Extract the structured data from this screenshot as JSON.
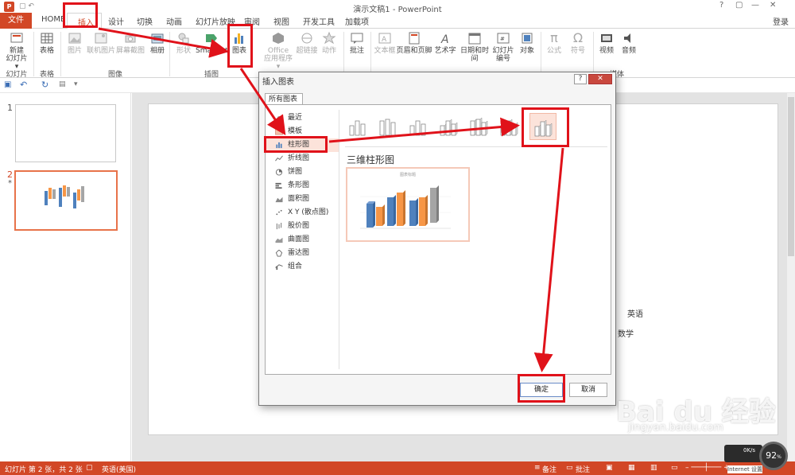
{
  "titlebar": {
    "title": "演示文稿1 - PowerPoint",
    "help": "?",
    "minimize": "—",
    "restore": "▢",
    "close": "✕"
  },
  "tabs": {
    "file": "文件",
    "home": "HOME",
    "insert": "插入",
    "design": "设计",
    "transitions": "切换",
    "animations": "动画",
    "slideshow": "幻灯片放映",
    "review": "审阅",
    "view": "视图",
    "developer": "开发工具",
    "addins": "加载项",
    "login": "登录"
  },
  "ribbon": {
    "new_slide": "新建",
    "new_slide_2": "幻灯片 ▾",
    "table": "表格",
    "picture": "图片",
    "online_picture": "联机图片",
    "screenshot": "屏幕截图",
    "album": "相册",
    "shapes": "形状",
    "smartart": "SmartArt",
    "chart": "图表",
    "office": "Office",
    "office2": "应用程序 ▾",
    "hyperlink": "超链接",
    "action": "动作",
    "comment": "批注",
    "textbox": "文本框",
    "header_footer": "页眉和页脚",
    "wordart": "艺术字",
    "datetime": "日期和时间",
    "slide_number": "幻灯片",
    "slide_number_2": "编号",
    "object": "对象",
    "equation": "公式",
    "symbol": "符号",
    "video": "视频",
    "audio": "音频",
    "groups": {
      "slides": "幻灯片",
      "tables": "表格",
      "images": "图像",
      "illustrations": "插图",
      "media": "媒体"
    }
  },
  "thumbnails": [
    {
      "number": "1"
    },
    {
      "number": "2",
      "marker": "*"
    }
  ],
  "slide_text": {
    "english": "英语",
    "math": "数学"
  },
  "dialog": {
    "title": "插入图表",
    "tab": "所有图表",
    "categories": [
      "最近",
      "模板",
      "柱形图",
      "折线图",
      "饼图",
      "条形图",
      "面积图",
      "X Y (散点图)",
      "股价图",
      "曲面图",
      "雷达图",
      "组合"
    ],
    "selected_category": "柱形图",
    "chart_type_title": "三维柱形图",
    "ok": "确定",
    "cancel": "取消",
    "preview_title": "图表标题"
  },
  "status": {
    "slide_info": "幻灯片 第 2 张，共 2 张",
    "language": "英语(美国)",
    "notes": "备注",
    "comments": "批注"
  },
  "watermark": {
    "brand": "Bai du 经验",
    "url": "jingyan.baidu.com"
  },
  "speed": {
    "percent": "92",
    "rate": "0K/s",
    "label": "Internet 设置"
  },
  "colors": {
    "accent": "#d24726",
    "highlight": "#e0121a",
    "bar_blue": "#4f81bd",
    "bar_orange": "#f79646",
    "bar_gray": "#a5a5a5"
  }
}
